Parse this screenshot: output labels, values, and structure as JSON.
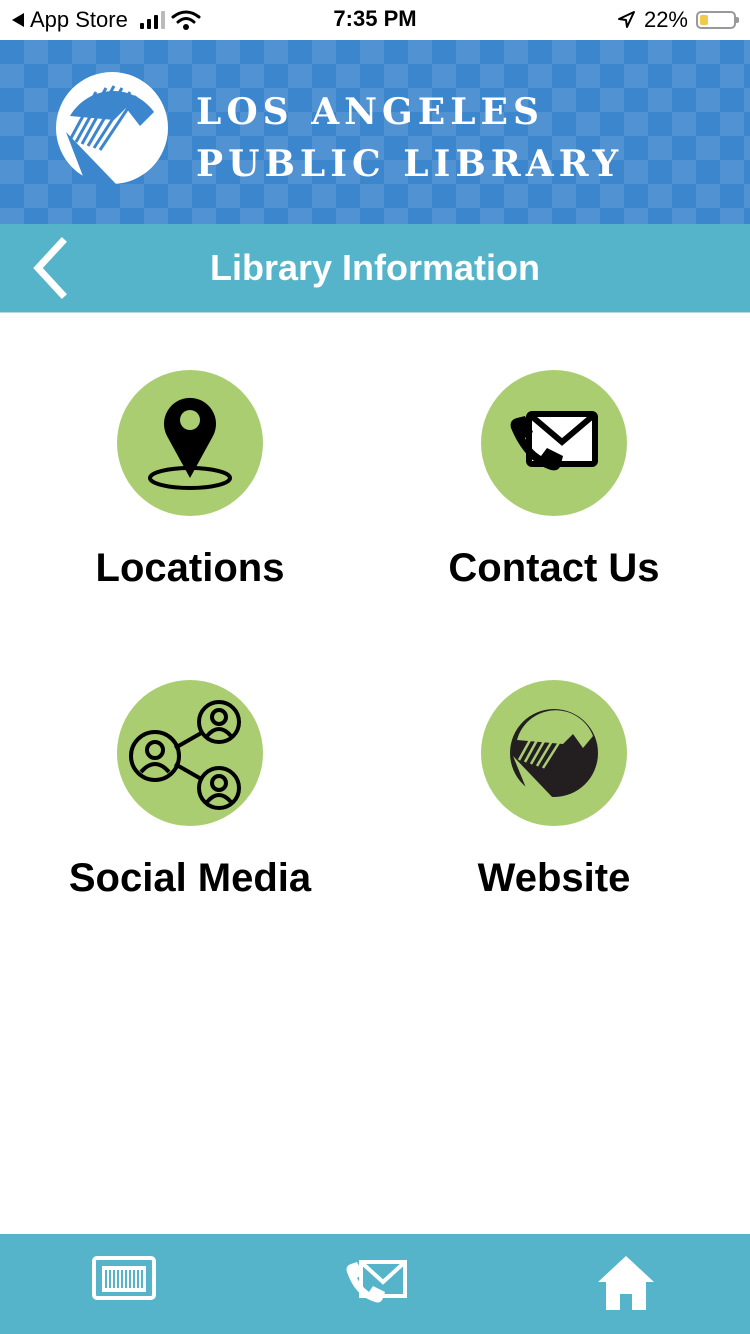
{
  "status_bar": {
    "back_app": "App Store",
    "time": "7:35 PM",
    "battery": "22%",
    "battery_level": 0.22,
    "icons": [
      "back-triangle-icon",
      "signal-icon",
      "wifi-icon",
      "location-arrow-icon",
      "battery-icon"
    ]
  },
  "header": {
    "line1": "LOS ANGELES",
    "line2": "PUBLIC LIBRARY",
    "logo_icon": "lapl-logo-icon"
  },
  "title_bar": {
    "title": "Library Information",
    "back_icon": "chevron-left-icon"
  },
  "menu": [
    {
      "label": "Locations",
      "icon": "map-pin-icon"
    },
    {
      "label": "Contact Us",
      "icon": "phone-mail-icon"
    },
    {
      "label": "Social Media",
      "icon": "share-people-icon"
    },
    {
      "label": "Website",
      "icon": "lapl-logo-icon"
    }
  ],
  "tab_bar": {
    "tabs": [
      {
        "icon": "library-card-icon"
      },
      {
        "icon": "phone-mail-icon"
      },
      {
        "icon": "home-icon"
      }
    ]
  },
  "colors": {
    "header_blue": "#3c86cd",
    "title_teal": "#55b4c9",
    "circle_green": "#aacd72"
  }
}
